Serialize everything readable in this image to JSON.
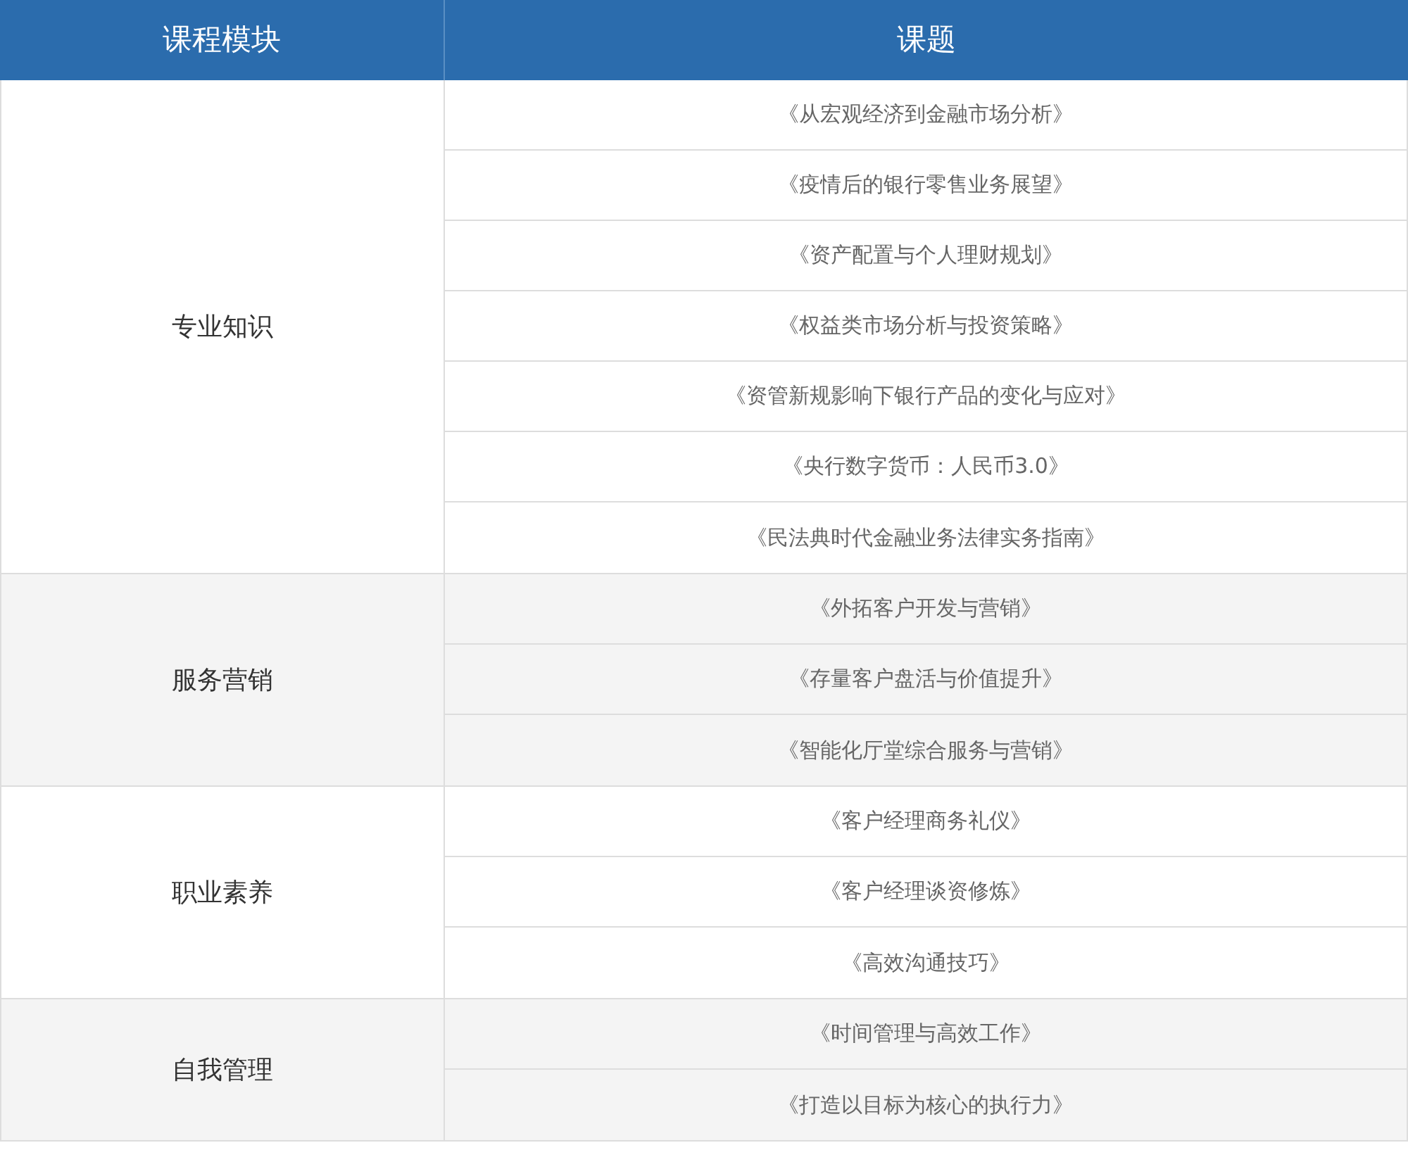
{
  "table": {
    "columns": [
      "课程模块",
      "课题"
    ],
    "groups": [
      {
        "module": "专业知识",
        "topics": [
          "《从宏观经济到金融市场分析》",
          "《疫情后的银行零售业务展望》",
          "《资产配置与个人理财规划》",
          "《权益类市场分析与投资策略》",
          "《资管新规影响下银行产品的变化与应对》",
          "《央行数字货币：人民币3.0》",
          "《民法典时代金融业务法律实务指南》"
        ]
      },
      {
        "module": "服务营销",
        "topics": [
          "《外拓客户开发与营销》",
          "《存量客户盘活与价值提升》",
          "《智能化厅堂综合服务与营销》"
        ]
      },
      {
        "module": "职业素养",
        "topics": [
          "《客户经理商务礼仪》",
          "《客户经理谈资修炼》",
          "《高效沟通技巧》"
        ]
      },
      {
        "module": "自我管理",
        "topics": [
          "《时间管理与高效工作》",
          "《打造以目标为核心的执行力》"
        ]
      }
    ]
  }
}
